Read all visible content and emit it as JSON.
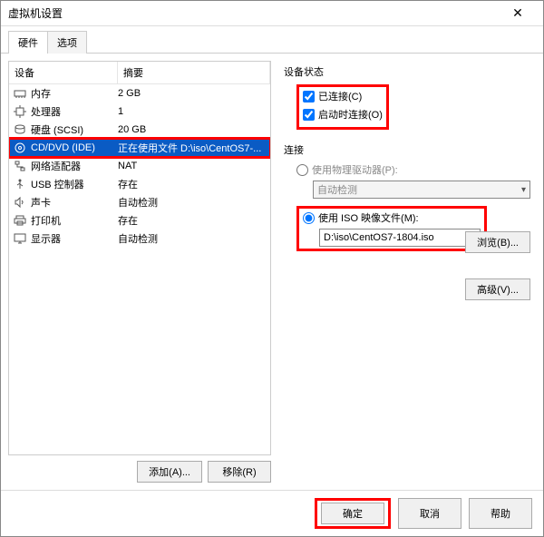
{
  "window": {
    "title": "虚拟机设置"
  },
  "tabs": {
    "hardware": "硬件",
    "options": "选项"
  },
  "deviceList": {
    "header": {
      "device": "设备",
      "summary": "摘要"
    },
    "rows": [
      {
        "icon": "memory",
        "name": "内存",
        "summary": "2 GB"
      },
      {
        "icon": "cpu",
        "name": "处理器",
        "summary": "1"
      },
      {
        "icon": "disk",
        "name": "硬盘 (SCSI)",
        "summary": "20 GB"
      },
      {
        "icon": "cd",
        "name": "CD/DVD (IDE)",
        "summary": "正在使用文件 D:\\iso\\CentOS7-..."
      },
      {
        "icon": "net",
        "name": "网络适配器",
        "summary": "NAT"
      },
      {
        "icon": "usb",
        "name": "USB 控制器",
        "summary": "存在"
      },
      {
        "icon": "sound",
        "name": "声卡",
        "summary": "自动检测"
      },
      {
        "icon": "printer",
        "name": "打印机",
        "summary": "存在"
      },
      {
        "icon": "display",
        "name": "显示器",
        "summary": "自动检测"
      }
    ]
  },
  "leftButtons": {
    "add": "添加(A)...",
    "remove": "移除(R)"
  },
  "status": {
    "title": "设备状态",
    "connected": "已连接(C)",
    "connectAtPowerOn": "启动时连接(O)"
  },
  "connection": {
    "title": "连接",
    "physical": "使用物理驱动器(P):",
    "autoDetect": "自动检测",
    "useIso": "使用 ISO 映像文件(M):",
    "isoPath": "D:\\iso\\CentOS7-1804.iso",
    "browse": "浏览(B)...",
    "advanced": "高级(V)..."
  },
  "footer": {
    "ok": "确定",
    "cancel": "取消",
    "help": "帮助"
  }
}
